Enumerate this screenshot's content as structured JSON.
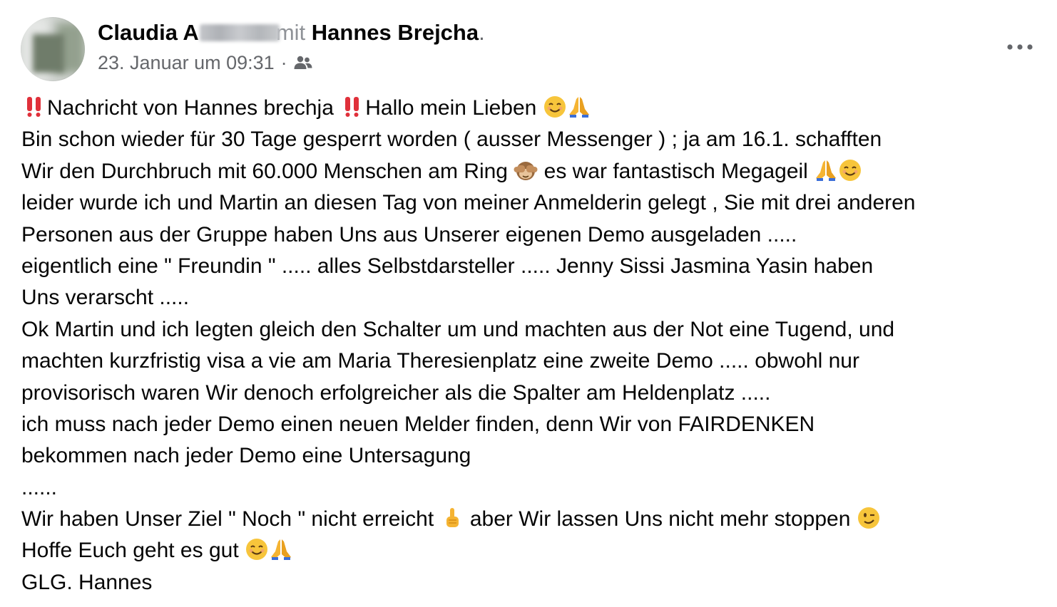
{
  "post": {
    "author": {
      "name_visible": "Claudia A",
      "with_word": "mit",
      "tagged_name": "Hannes Brejcha",
      "period": "."
    },
    "meta": {
      "timestamp": "23. Januar um 09:31",
      "separator": "·",
      "audience_icon": "friends-icon"
    },
    "more_icon": "more-options-icon",
    "lines": [
      {
        "segments": [
          "",
          "Nachricht von Hannes brechja ",
          "Hallo mein Lieben "
        ]
      },
      {
        "segments": [
          "Bin schon wieder für 30 Tage gesperrt worden ( ausser Messenger ) ; ja am 16.1.  schafften"
        ]
      },
      {
        "segments": [
          "Wir den Durchbruch mit 60.000 Menschen am Ring ",
          " es war fantastisch Megageil  "
        ]
      },
      {
        "segments": [
          "leider wurde ich und Martin an diesen Tag von meiner Anmelderin gelegt , Sie mit drei anderen"
        ]
      },
      {
        "segments": [
          "Personen aus der Gruppe haben Uns aus Unserer eigenen Demo ausgeladen  ....."
        ]
      },
      {
        "segments": [
          "eigentlich eine \" Freundin \"  ..... alles Selbstdarsteller  ..... Jenny Sissi Jasmina Yasin haben"
        ]
      },
      {
        "segments": [
          "Uns verarscht  ....."
        ]
      },
      {
        "segments": [
          "Ok Martin und ich legten gleich den Schalter um und machten aus der Not eine Tugend, und"
        ]
      },
      {
        "segments": [
          "machten kurzfristig visa a vie am Maria Theresienplatz eine zweite Demo  ..... obwohl nur"
        ]
      },
      {
        "segments": [
          "provisorisch waren Wir denoch erfolgreicher als die Spalter am Heldenplatz  ....."
        ]
      },
      {
        "segments": [
          "ich muss nach jeder Demo einen neuen Melder finden, denn Wir von FAIRDENKEN"
        ]
      },
      {
        "segments": [
          "bekommen nach jeder Demo eine Untersagung"
        ]
      },
      {
        "segments": [
          "......"
        ]
      },
      {
        "segments": [
          "Wir haben Unser Ziel \" Noch \" nicht erreicht  ",
          "  aber Wir lassen Uns nicht mehr stoppen  "
        ]
      },
      {
        "segments": [
          "Hoffe Euch geht es gut  "
        ]
      },
      {
        "segments": [
          "GLG. Hannes"
        ]
      }
    ],
    "emoji_names": {
      "double_exclamation": "double-exclamation-icon",
      "smile": "smiling-face-icon",
      "pray": "folded-hands-icon",
      "see_no_evil": "see-no-evil-monkey-icon",
      "point_up": "index-pointing-up-icon",
      "wink": "winking-face-icon"
    },
    "colors": {
      "text": "#050505",
      "secondary": "#65676b",
      "emoji_red": "#e0303a",
      "emoji_yellow": "#f7c53b",
      "emoji_orange": "#f5a623"
    }
  }
}
